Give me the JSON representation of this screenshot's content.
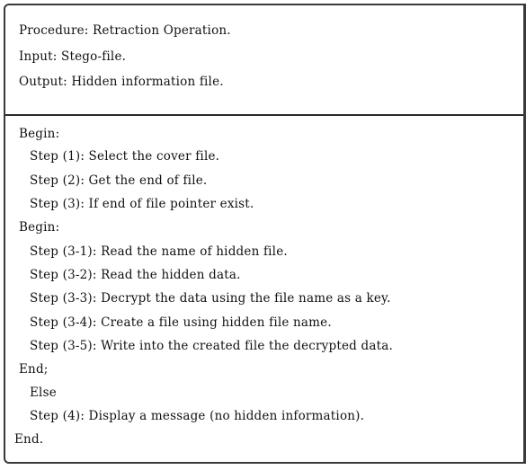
{
  "procedure": {
    "title": "Procedure: Retraction Operation.",
    "input": "Input: Stego-file.",
    "output": "Output: Hidden information file."
  },
  "algorithm": {
    "lines": [
      "Begin:",
      "Step (1): Select the cover file.",
      "Step (2): Get the end of file.",
      "Step (3): If end of file pointer exist.",
      "Begin:",
      "Step (3-1): Read the name of hidden file.",
      "Step (3-2): Read the hidden data.",
      "Step (3-3): Decrypt the data using the file name as a key.",
      "Step (3-4): Create a file using hidden file name.",
      "Step (3-5): Write into the created file the decrypted data.",
      "End;",
      "Else",
      "Step (4): Display a message (no hidden information).",
      "End."
    ]
  }
}
